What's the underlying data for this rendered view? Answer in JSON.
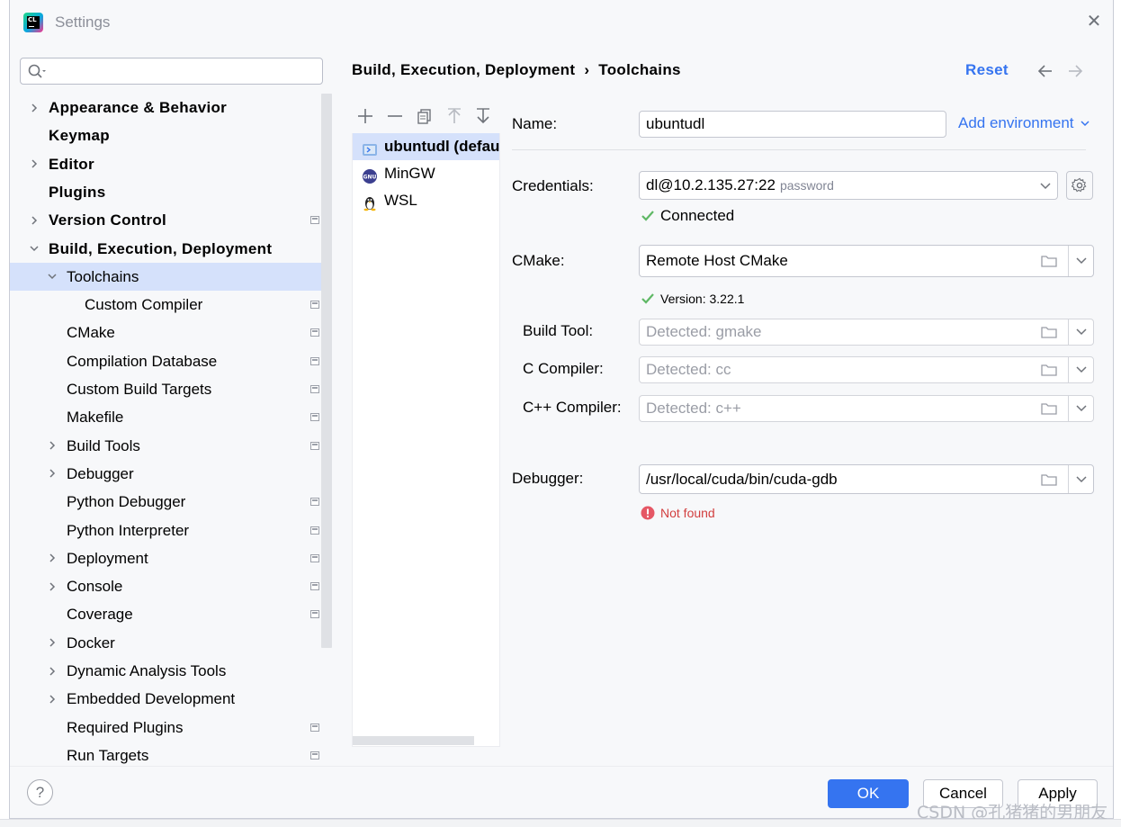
{
  "window": {
    "title": "Settings"
  },
  "search": {
    "placeholder": "",
    "value": ""
  },
  "tree": [
    {
      "label": "Appearance & Behavior",
      "bold": true,
      "expandable": true,
      "expanded": false,
      "project": false,
      "indent": 0
    },
    {
      "label": "Keymap",
      "bold": true,
      "expandable": false,
      "project": false,
      "indent": 0
    },
    {
      "label": "Editor",
      "bold": true,
      "expandable": true,
      "expanded": false,
      "project": false,
      "indent": 0
    },
    {
      "label": "Plugins",
      "bold": true,
      "expandable": false,
      "project": false,
      "indent": 0
    },
    {
      "label": "Version Control",
      "bold": true,
      "expandable": true,
      "expanded": false,
      "project": true,
      "indent": 0
    },
    {
      "label": "Build, Execution, Deployment",
      "bold": true,
      "expandable": true,
      "expanded": true,
      "project": false,
      "indent": 0
    },
    {
      "label": "Toolchains",
      "bold": false,
      "expandable": true,
      "expanded": true,
      "project": false,
      "indent": 1,
      "selected": true
    },
    {
      "label": "Custom Compiler",
      "bold": false,
      "expandable": false,
      "project": true,
      "indent": 2
    },
    {
      "label": "CMake",
      "bold": false,
      "expandable": false,
      "project": true,
      "indent": 1
    },
    {
      "label": "Compilation Database",
      "bold": false,
      "expandable": false,
      "project": true,
      "indent": 1
    },
    {
      "label": "Custom Build Targets",
      "bold": false,
      "expandable": false,
      "project": true,
      "indent": 1
    },
    {
      "label": "Makefile",
      "bold": false,
      "expandable": false,
      "project": true,
      "indent": 1
    },
    {
      "label": "Build Tools",
      "bold": false,
      "expandable": true,
      "expanded": false,
      "project": true,
      "indent": 1
    },
    {
      "label": "Debugger",
      "bold": false,
      "expandable": true,
      "expanded": false,
      "project": false,
      "indent": 1
    },
    {
      "label": "Python Debugger",
      "bold": false,
      "expandable": false,
      "project": true,
      "indent": 1
    },
    {
      "label": "Python Interpreter",
      "bold": false,
      "expandable": false,
      "project": true,
      "indent": 1
    },
    {
      "label": "Deployment",
      "bold": false,
      "expandable": true,
      "expanded": false,
      "project": true,
      "indent": 1
    },
    {
      "label": "Console",
      "bold": false,
      "expandable": true,
      "expanded": false,
      "project": true,
      "indent": 1
    },
    {
      "label": "Coverage",
      "bold": false,
      "expandable": false,
      "project": true,
      "indent": 1
    },
    {
      "label": "Docker",
      "bold": false,
      "expandable": true,
      "expanded": false,
      "project": false,
      "indent": 1
    },
    {
      "label": "Dynamic Analysis Tools",
      "bold": false,
      "expandable": true,
      "expanded": false,
      "project": false,
      "indent": 1
    },
    {
      "label": "Embedded Development",
      "bold": false,
      "expandable": true,
      "expanded": false,
      "project": false,
      "indent": 1
    },
    {
      "label": "Required Plugins",
      "bold": false,
      "expandable": false,
      "project": true,
      "indent": 1
    },
    {
      "label": "Run Targets",
      "bold": false,
      "expandable": false,
      "project": true,
      "indent": 1
    }
  ],
  "breadcrumb": {
    "parent": "Build, Execution, Deployment",
    "separator": "›",
    "current": "Toolchains"
  },
  "header": {
    "reset": "Reset"
  },
  "toolchains": [
    {
      "name": "ubuntudl (defau",
      "icon": "remote-host-icon",
      "selected": true
    },
    {
      "name": "MinGW",
      "icon": "gnu-icon",
      "selected": false
    },
    {
      "name": "WSL",
      "icon": "linux-penguin-icon",
      "selected": false
    }
  ],
  "form": {
    "name_label": "Name:",
    "name_value": "ubuntudl",
    "add_environment": "Add environment",
    "credentials_label": "Credentials:",
    "credentials_value": "dl@10.2.135.27:22",
    "credentials_hint": "password",
    "connected": "Connected",
    "cmake_label": "CMake:",
    "cmake_value": "Remote Host CMake",
    "cmake_version": "Version: 3.22.1",
    "build_tool_label": "Build Tool:",
    "build_tool_value": "Detected: gmake",
    "c_compiler_label": "C Compiler:",
    "c_compiler_value": "Detected: cc",
    "cpp_compiler_label": "C++ Compiler:",
    "cpp_compiler_value": "Detected: c++",
    "debugger_label": "Debugger:",
    "debugger_value": "/usr/local/cuda/bin/cuda-gdb",
    "debugger_status": "Not found"
  },
  "buttons": {
    "help": "?",
    "ok": "OK",
    "cancel": "Cancel",
    "apply": "Apply"
  },
  "watermark": "CSDN @孔猪猪的男朋友",
  "colors": {
    "accent": "#3574f0",
    "selection": "#d5e1fb",
    "success": "#5fb865",
    "error": "#d23f3f"
  }
}
